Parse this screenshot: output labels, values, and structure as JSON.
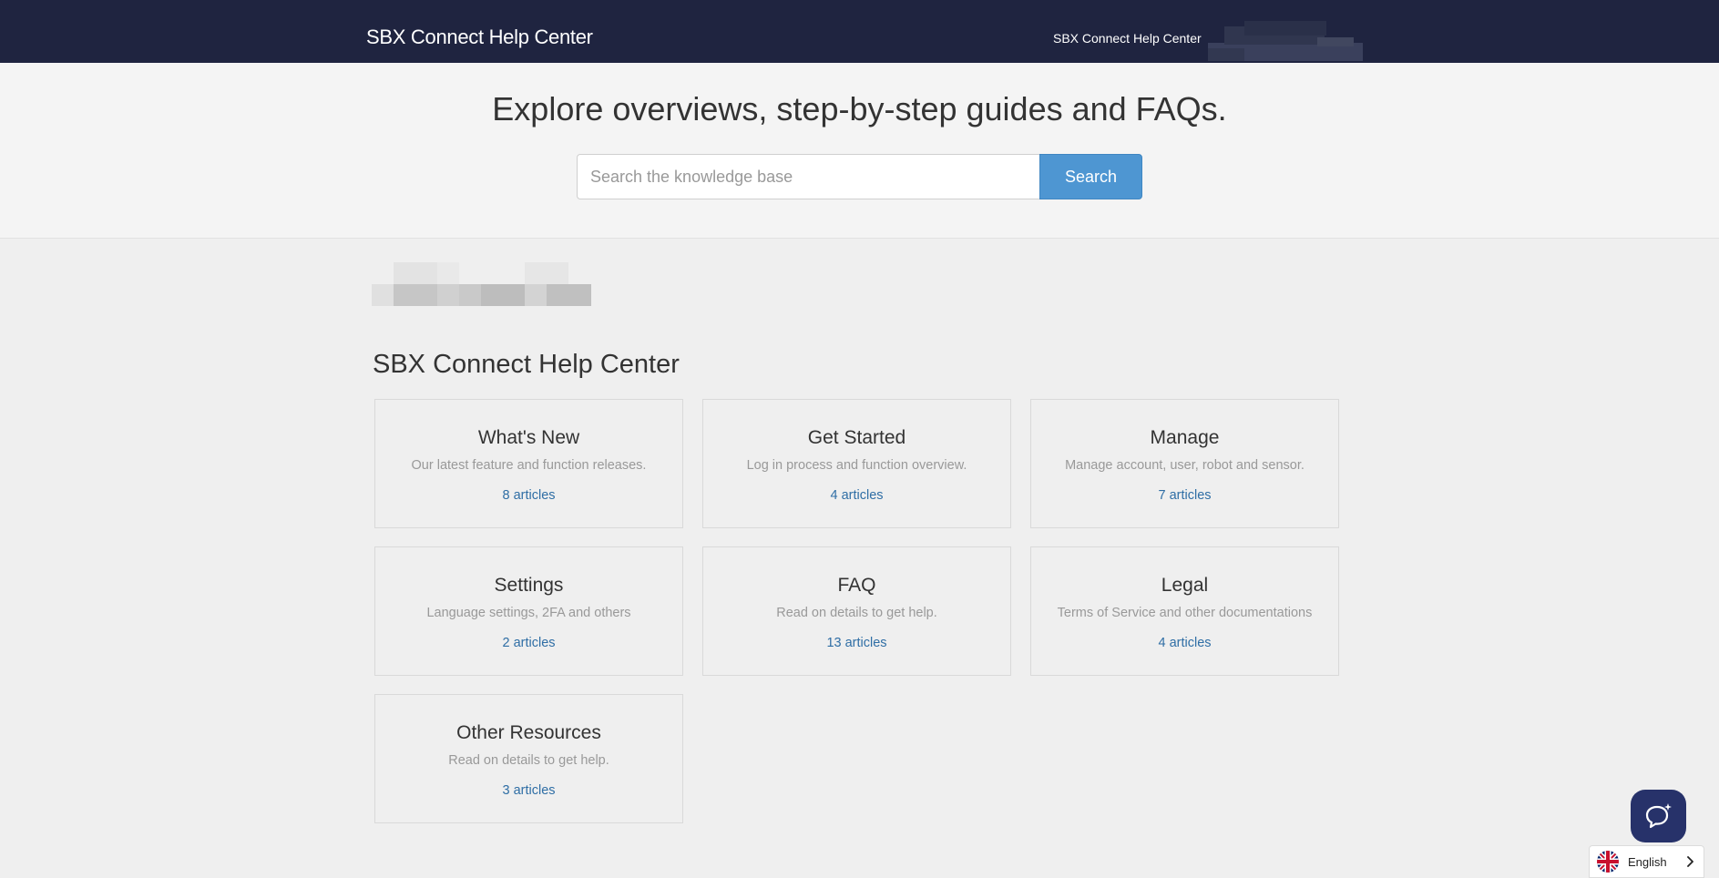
{
  "header": {
    "brand": "SBX Connect Help Center",
    "nav_link": "SBX Connect Help Center"
  },
  "hero": {
    "title": "Explore overviews, step-by-step guides and FAQs.",
    "search_placeholder": "Search the knowledge base",
    "search_button": "Search"
  },
  "main": {
    "section_title": "SBX Connect Help Center",
    "categories": [
      {
        "title": "What's New",
        "description": "Our latest feature and function releases.",
        "count": "8 articles"
      },
      {
        "title": "Get Started",
        "description": "Log in process and function overview.",
        "count": "4 articles"
      },
      {
        "title": "Manage",
        "description": "Manage account, user, robot and sensor.",
        "count": "7 articles"
      },
      {
        "title": "Settings",
        "description": "Language settings, 2FA and others",
        "count": "2 articles"
      },
      {
        "title": "FAQ",
        "description": "Read on details to get help.",
        "count": "13 articles"
      },
      {
        "title": "Legal",
        "description": "Terms of Service and other documentations",
        "count": "4 articles"
      },
      {
        "title": "Other Resources",
        "description": "Read on details to get help.",
        "count": "3 articles"
      }
    ]
  },
  "language": {
    "current": "English"
  },
  "colors": {
    "nav_bg": "#1f2440",
    "search_button": "#4e96d2",
    "link": "#2f6ea5",
    "chat_bg": "#27326a"
  },
  "icons": {
    "chat": "chat-bubble-sparkle-icon",
    "language_flag": "uk-flag-icon",
    "chevron": "chevron-right-icon"
  }
}
